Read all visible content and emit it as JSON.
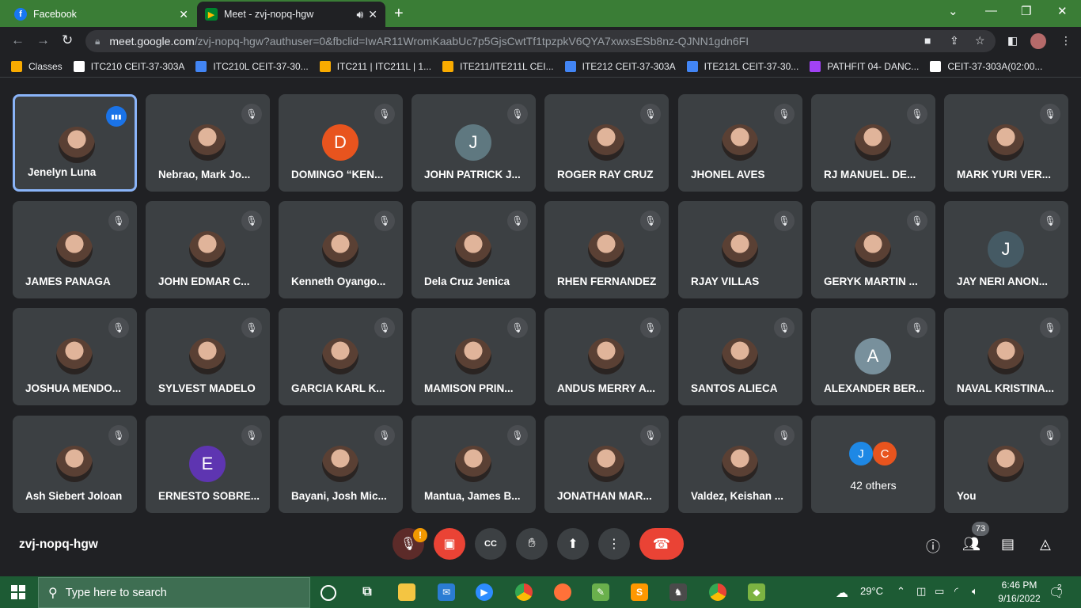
{
  "browser": {
    "tabs": [
      {
        "title": "Facebook",
        "icon": "facebook-icon"
      },
      {
        "title": "Meet - zvj-nopq-hgw",
        "icon": "meet-icon"
      }
    ],
    "url_host": "meet.google.com",
    "url_path": "/zvj-nopq-hgw?authuser=0&fbclid=IwAR11WromKaabUc7p5GjsCwtTf1tpzpkV6QYA7xwxsESb8nz-QJNN1gdn6FI",
    "bookmarks": [
      {
        "label": "Classes",
        "color": "#f9ab00"
      },
      {
        "label": "ITC210 CEIT-37-303A",
        "color": "#ffffff"
      },
      {
        "label": "ITC210L CEIT-37-30...",
        "color": "#4285f4"
      },
      {
        "label": "ITC211 | ITC211L | 1...",
        "color": "#f9ab00"
      },
      {
        "label": "ITE211/ITE211L CEI...",
        "color": "#f9ab00"
      },
      {
        "label": "ITE212 CEIT-37-303A",
        "color": "#4285f4"
      },
      {
        "label": "ITE212L CEIT-37-30...",
        "color": "#4285f4"
      },
      {
        "label": "PATHFIT 04- DANC...",
        "color": "#a142f4"
      },
      {
        "label": "CEIT-37-303A(02:00...",
        "color": "#ffffff"
      }
    ]
  },
  "meet": {
    "meeting_code": "zvj-nopq-hgw",
    "participants": [
      {
        "name": "Jenelyn Luna",
        "type": "photo",
        "speaking": true
      },
      {
        "name": "Nebrao, Mark Jo...",
        "type": "photo"
      },
      {
        "name": "DOMINGO “KEN...",
        "type": "letter",
        "letter": "D",
        "color": "#e8541e"
      },
      {
        "name": "JOHN PATRICK J...",
        "type": "letter",
        "letter": "J",
        "color": "#5f7880"
      },
      {
        "name": "ROGER RAY CRUZ",
        "type": "photo"
      },
      {
        "name": "JHONEL AVES",
        "type": "photo"
      },
      {
        "name": "RJ MANUEL. DE...",
        "type": "photo"
      },
      {
        "name": "MARK YURI VER...",
        "type": "photo"
      },
      {
        "name": "JAMES PANAGA",
        "type": "photo"
      },
      {
        "name": "JOHN EDMAR C...",
        "type": "photo"
      },
      {
        "name": "Kenneth Oyango...",
        "type": "photo"
      },
      {
        "name": "Dela Cruz Jenica",
        "type": "photo"
      },
      {
        "name": "RHEN FERNANDEZ",
        "type": "photo"
      },
      {
        "name": "RJAY VILLAS",
        "type": "photo"
      },
      {
        "name": "GERYK MARTIN ...",
        "type": "photo"
      },
      {
        "name": "JAY NERI ANON...",
        "type": "letter",
        "letter": "J",
        "color": "#455a64"
      },
      {
        "name": "JOSHUA MENDO...",
        "type": "photo"
      },
      {
        "name": "SYLVEST MADELO",
        "type": "photo"
      },
      {
        "name": "GARCIA KARL K...",
        "type": "photo"
      },
      {
        "name": "MAMISON PRIN...",
        "type": "photo"
      },
      {
        "name": "ANDUS MERRY A...",
        "type": "photo"
      },
      {
        "name": "SANTOS ALIECA",
        "type": "photo"
      },
      {
        "name": "ALEXANDER BER...",
        "type": "letter",
        "letter": "A",
        "color": "#78909c"
      },
      {
        "name": "NAVAL KRISTINA...",
        "type": "photo"
      },
      {
        "name": "Ash Siebert Joloan",
        "type": "photo"
      },
      {
        "name": "ERNESTO SOBRE...",
        "type": "letter",
        "letter": "E",
        "color": "#5e35b1"
      },
      {
        "name": "Bayani, Josh Mic...",
        "type": "photo"
      },
      {
        "name": "Mantua, James B...",
        "type": "photo"
      },
      {
        "name": "JONATHAN MAR...",
        "type": "photo"
      },
      {
        "name": "Valdez, Keishan ...",
        "type": "photo"
      },
      {
        "name": "42 others",
        "type": "others",
        "letters": [
          "J",
          "C"
        ],
        "colors": [
          "#1e88e5",
          "#e8541e"
        ]
      },
      {
        "name": "You",
        "type": "photo"
      }
    ],
    "participant_count": "73"
  },
  "taskbar": {
    "search_placeholder": "Type here to search",
    "temperature": "29°C",
    "time": "6:46 PM",
    "date": "9/16/2022",
    "notification_count": "2"
  }
}
